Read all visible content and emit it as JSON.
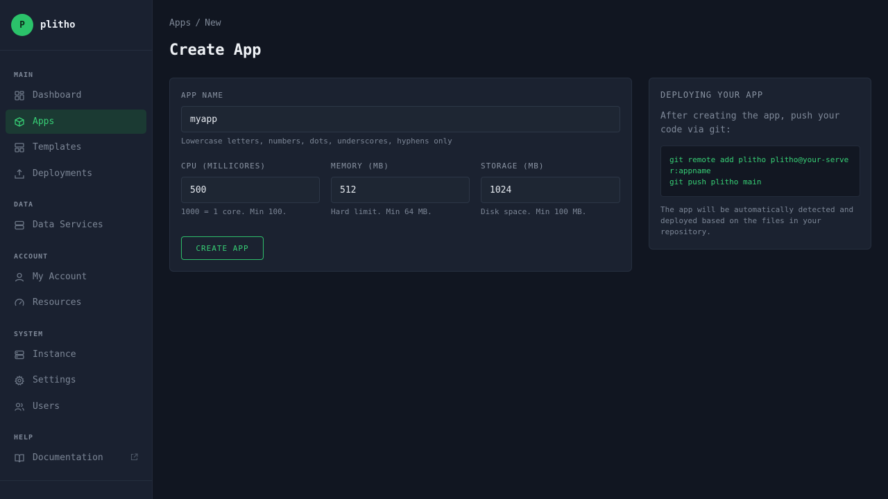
{
  "brand": {
    "logo_letter": "P",
    "name": "plitho",
    "accent": "#2bc26a"
  },
  "sidebar": {
    "sections": {
      "main": "MAIN",
      "data": "DATA",
      "account": "ACCOUNT",
      "system": "SYSTEM",
      "help": "HELP"
    },
    "items": {
      "dashboard": {
        "label": "Dashboard",
        "icon": "grid-icon"
      },
      "apps": {
        "label": "Apps",
        "icon": "cube-icon",
        "active": true
      },
      "templates": {
        "label": "Templates",
        "icon": "layout-icon"
      },
      "deployments": {
        "label": "Deployments",
        "icon": "upload-icon"
      },
      "data_services": {
        "label": "Data Services",
        "icon": "database-icon"
      },
      "my_account": {
        "label": "My Account",
        "icon": "user-icon"
      },
      "resources": {
        "label": "Resources",
        "icon": "gauge-icon"
      },
      "instance": {
        "label": "Instance",
        "icon": "server-icon"
      },
      "settings": {
        "label": "Settings",
        "icon": "gear-icon"
      },
      "users": {
        "label": "Users",
        "icon": "users-icon"
      },
      "documentation": {
        "label": "Documentation",
        "icon": "book-icon"
      }
    }
  },
  "breadcrumb": {
    "parent": "Apps",
    "separator": "/",
    "current": "New"
  },
  "page": {
    "title": "Create App"
  },
  "form": {
    "app_name": {
      "label": "APP NAME",
      "value": "myapp",
      "hint": "Lowercase letters, numbers, dots, underscores, hyphens only"
    },
    "cpu": {
      "label": "CPU (MILLICORES)",
      "value": "500",
      "hint": "1000 = 1 core. Min 100."
    },
    "memory": {
      "label": "MEMORY (MB)",
      "value": "512",
      "hint": "Hard limit. Min 64 MB."
    },
    "storage": {
      "label": "STORAGE (MB)",
      "value": "1024",
      "hint": "Disk space. Min 100 MB."
    },
    "submit_label": "CREATE APP"
  },
  "info": {
    "title": "DEPLOYING YOUR APP",
    "description": "After creating the app, push your code via git:",
    "code_lines": [
      "git remote add plitho plitho@your-server:appname",
      "git push plitho main"
    ],
    "note": "The app will be automatically detected and deployed based on the files in your repository."
  }
}
